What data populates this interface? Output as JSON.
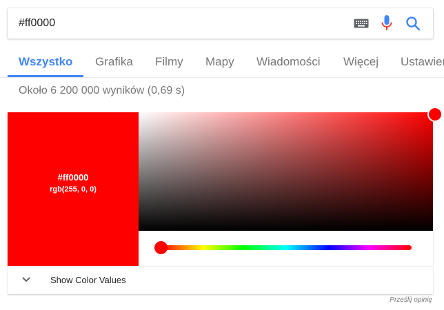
{
  "search": {
    "query": "#ff0000"
  },
  "tabs": [
    {
      "label": "Wszystko",
      "active": true
    },
    {
      "label": "Grafika",
      "active": false
    },
    {
      "label": "Filmy",
      "active": false
    },
    {
      "label": "Mapy",
      "active": false
    },
    {
      "label": "Wiadomości",
      "active": false
    },
    {
      "label": "Więcej",
      "active": false
    },
    {
      "label": "Ustawienia",
      "active": false
    }
  ],
  "results": {
    "stats": "Około 6 200 000 wyników (0,69 s)"
  },
  "color_picker": {
    "hex": "#ff0000",
    "rgb": "rgb(255, 0, 0)",
    "hue_fraction": 0.0,
    "saturation": 1.0,
    "value": 1.0,
    "toggle_label": "Show Color Values"
  },
  "footer": {
    "feedback": "Prześlij opinię"
  },
  "colors": {
    "accent": "#4285f4",
    "selected": "#ff0000",
    "mic_blue": "#4285f4",
    "mic_red": "#ea4335"
  },
  "icons": {
    "keyboard": "keyboard-icon",
    "mic": "microphone-icon",
    "search": "search-icon",
    "chevron": "chevron-down-icon"
  }
}
